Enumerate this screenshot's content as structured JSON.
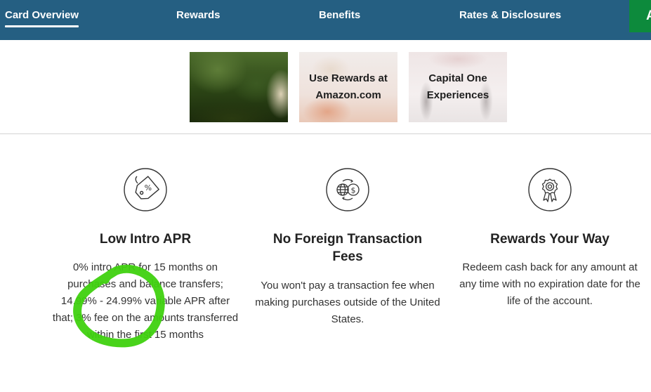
{
  "nav": {
    "items": [
      "Card Overview",
      "Rewards",
      "Benefits",
      "Rates & Disclosures"
    ],
    "active": "Card Overview",
    "apply_partial_label": "A"
  },
  "tiles": [
    {
      "label": "",
      "kind": "photo"
    },
    {
      "label": "Use Rewards at\nAmazon.com",
      "kind": "amazon"
    },
    {
      "label": "Capital One\nExperiences",
      "kind": "experiences"
    }
  ],
  "features": [
    {
      "icon": "price-tag-percent-icon",
      "title": "Low Intro APR",
      "body": "0% intro APR for 15 months on purchases and balance transfers; 14.99% - 24.99% variable APR after that; 3% fee on the amounts transferred within the first 15 months"
    },
    {
      "icon": "globe-dollar-exchange-icon",
      "title": "No Foreign Transaction Fees",
      "body": "You won't pay a transaction fee when making purchases outside of the United States."
    },
    {
      "icon": "award-ribbon-icon",
      "title": "Rewards Your Way",
      "body": "Redeem cash back for any amount at any time with no expiration date for the life of the account."
    }
  ],
  "colors": {
    "nav_bg": "#255f82",
    "apply_green": "#0d8a3c",
    "annotation_green": "#3fd10f"
  }
}
